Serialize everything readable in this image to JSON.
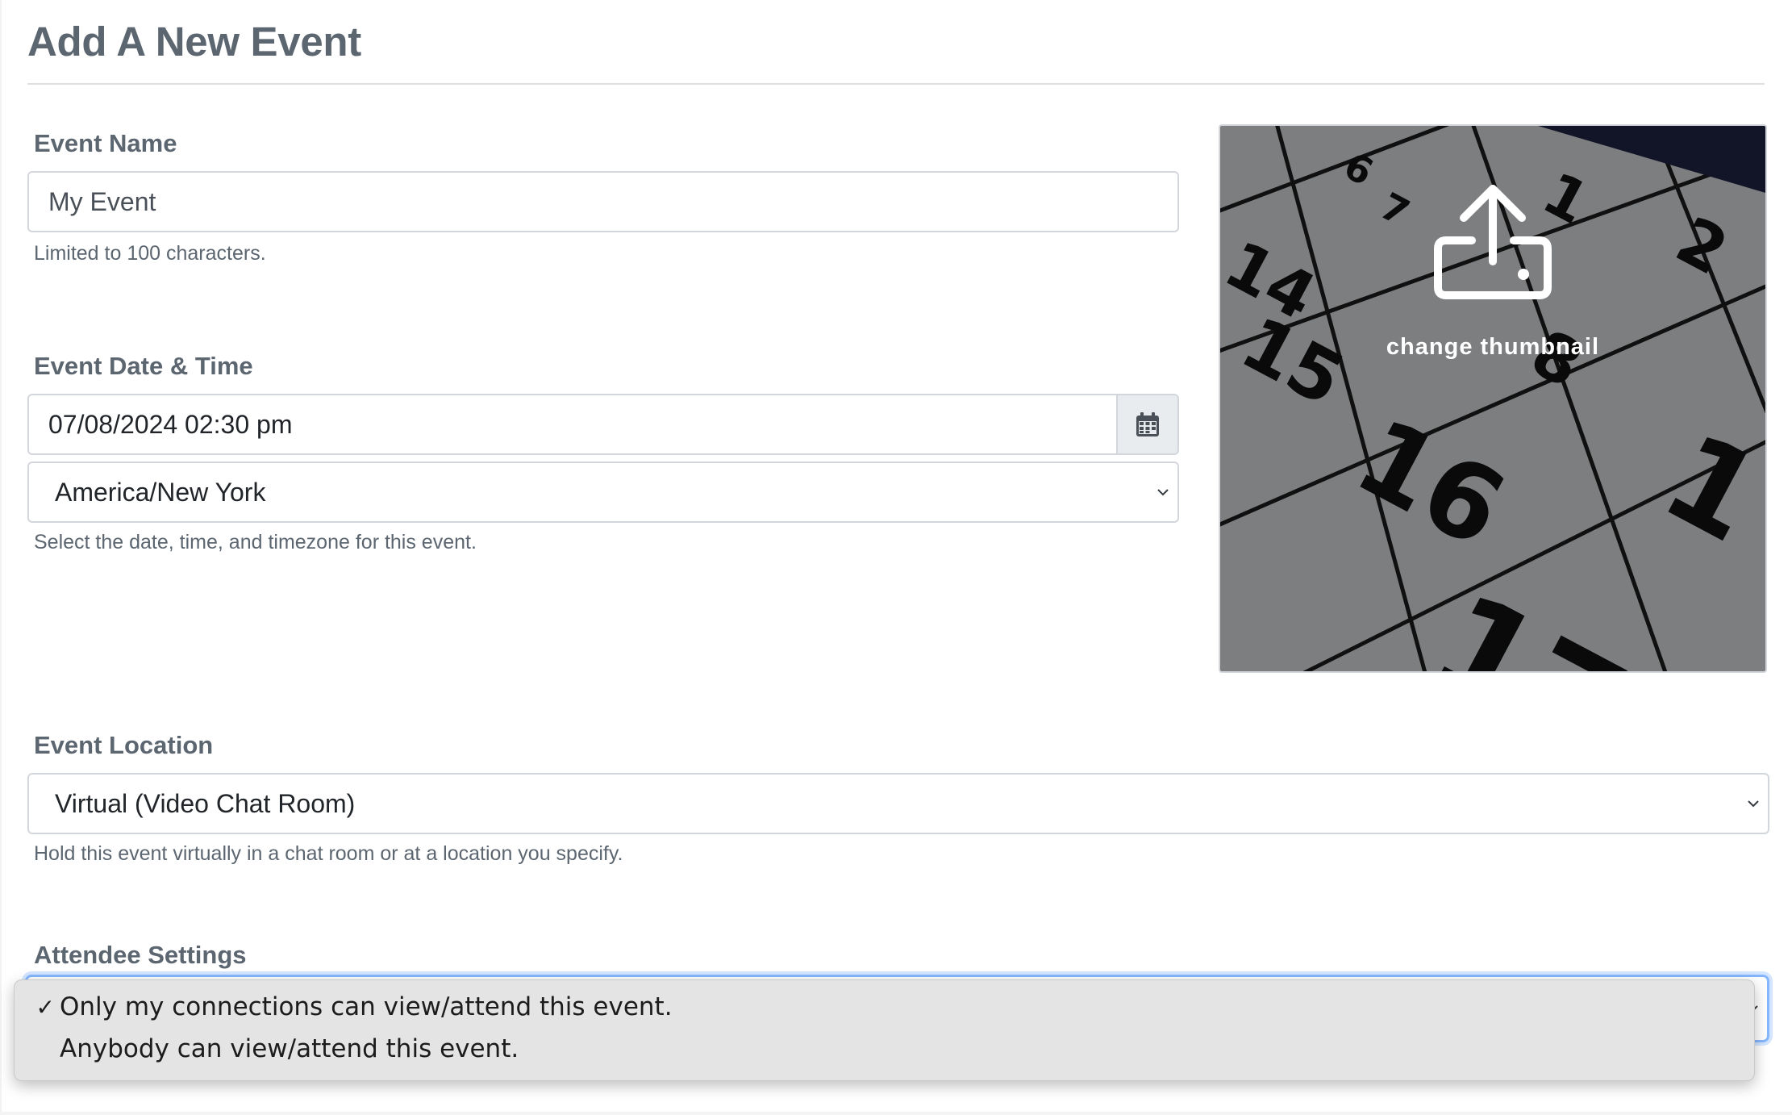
{
  "page": {
    "title": "Add A New Event"
  },
  "event_name": {
    "label": "Event Name",
    "value": "My Event",
    "help": "Limited to 100 characters."
  },
  "event_datetime": {
    "label": "Event Date & Time",
    "value": "07/08/2024 02:30 pm",
    "calendar_icon": "calendar-icon",
    "timezone": "America/New York",
    "help": "Select the date, time, and timezone for this event."
  },
  "thumbnail": {
    "caption": "change thumbnail",
    "icon": "upload-icon"
  },
  "event_location": {
    "label": "Event Location",
    "value": "Virtual (Video Chat Room)",
    "help": "Hold this event virtually in a chat room or at a location you specify."
  },
  "attendee_settings": {
    "label": "Attendee Settings",
    "options": [
      {
        "label": "Only my connections can view/attend this event.",
        "selected": true
      },
      {
        "label": "Anybody can view/attend this event.",
        "selected": false
      }
    ],
    "check_mark": "✓"
  },
  "colors": {
    "label_text": "#5c6670",
    "input_border": "#d3d7db",
    "focus_border": "#86b7fe",
    "addon_bg": "#e9ecef",
    "dropdown_bg": "#e4e4e4"
  }
}
